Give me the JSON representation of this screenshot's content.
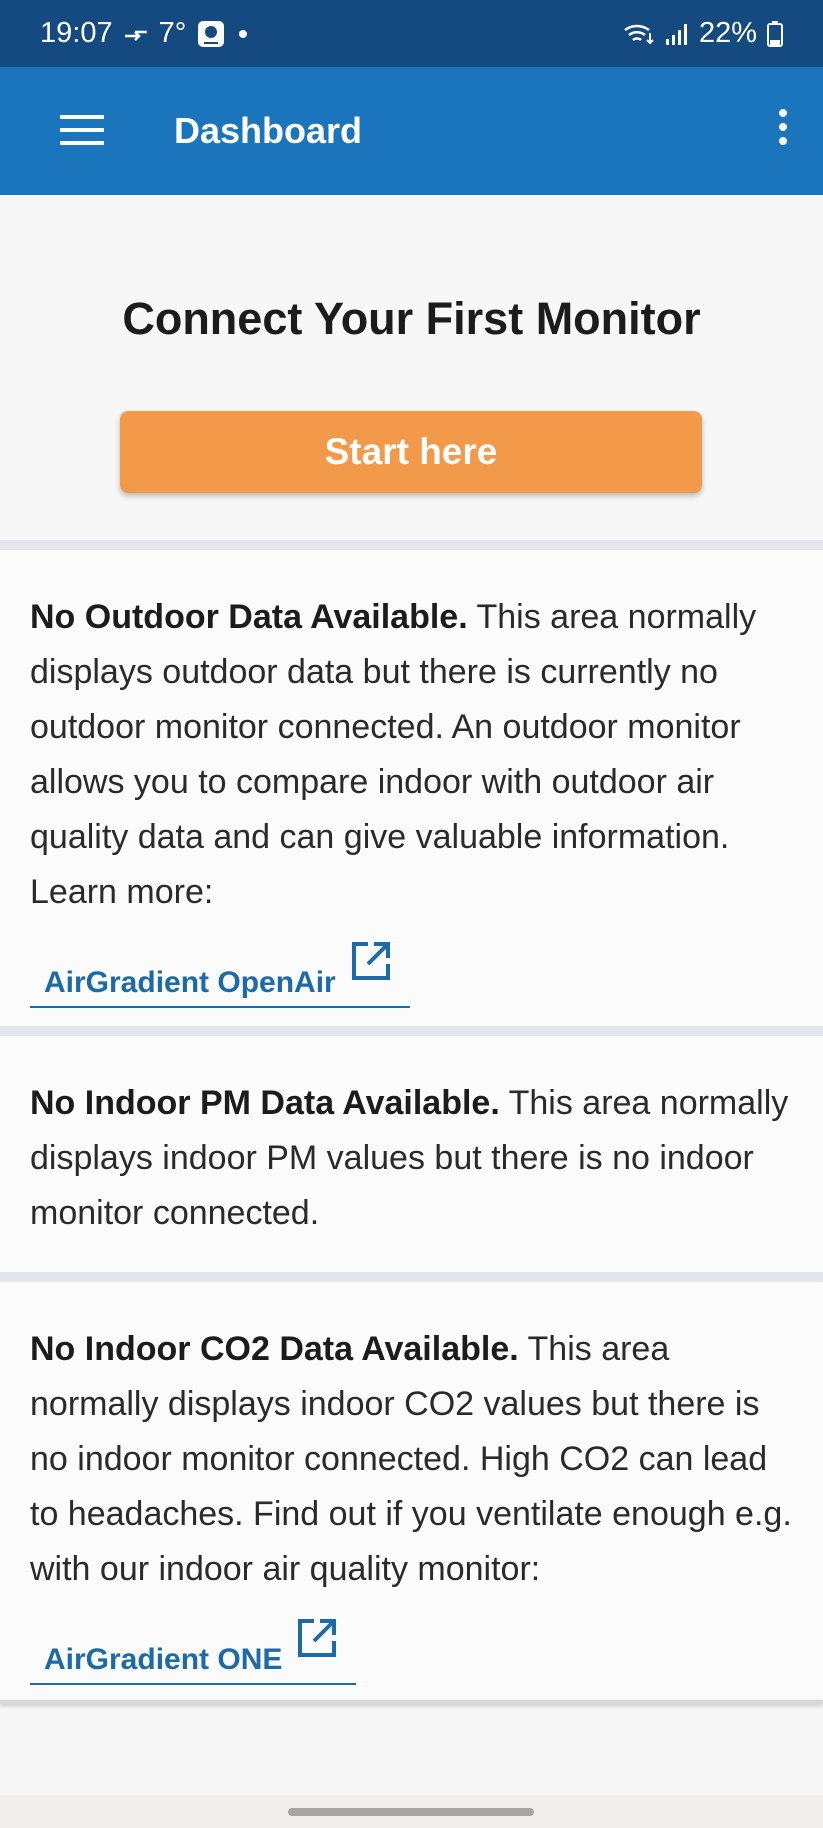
{
  "status_bar": {
    "time": "19:07",
    "temperature": "7°",
    "battery": "22%",
    "icons": [
      "transfer-icon",
      "camera-app-icon",
      "dot-icon",
      "wifi-icon",
      "signal-icon",
      "battery-icon"
    ]
  },
  "app_bar": {
    "title": "Dashboard",
    "menu_icon": "hamburger-icon",
    "more_icon": "more-vert-icon"
  },
  "hero": {
    "title": "Connect Your First Monitor",
    "button_label": "Start here",
    "button_color": "#f29a4a"
  },
  "cards": [
    {
      "heading": "No Outdoor Data Available.",
      "text": " This area normally displays outdoor data but there is currently no outdoor monitor connected. An outdoor monitor allows you to compare indoor with outdoor air quality data and can give valuable information. Learn more:",
      "link_label": "AirGradient OpenAir"
    },
    {
      "heading": "No Indoor PM Data Available.",
      "text": " This area normally displays indoor PM values but there is no indoor monitor connected."
    },
    {
      "heading": "No Indoor CO2 Data Available.",
      "text": " This area normally displays indoor CO2 values but there is no indoor monitor connected. High CO2 can lead to headaches. Find out if you ventilate enough e.g. with our indoor air quality monitor:",
      "link_label": "AirGradient ONE"
    }
  ],
  "colors": {
    "status_bar": "#154a80",
    "app_bar": "#1b75bc",
    "link": "#1c6aa8"
  }
}
